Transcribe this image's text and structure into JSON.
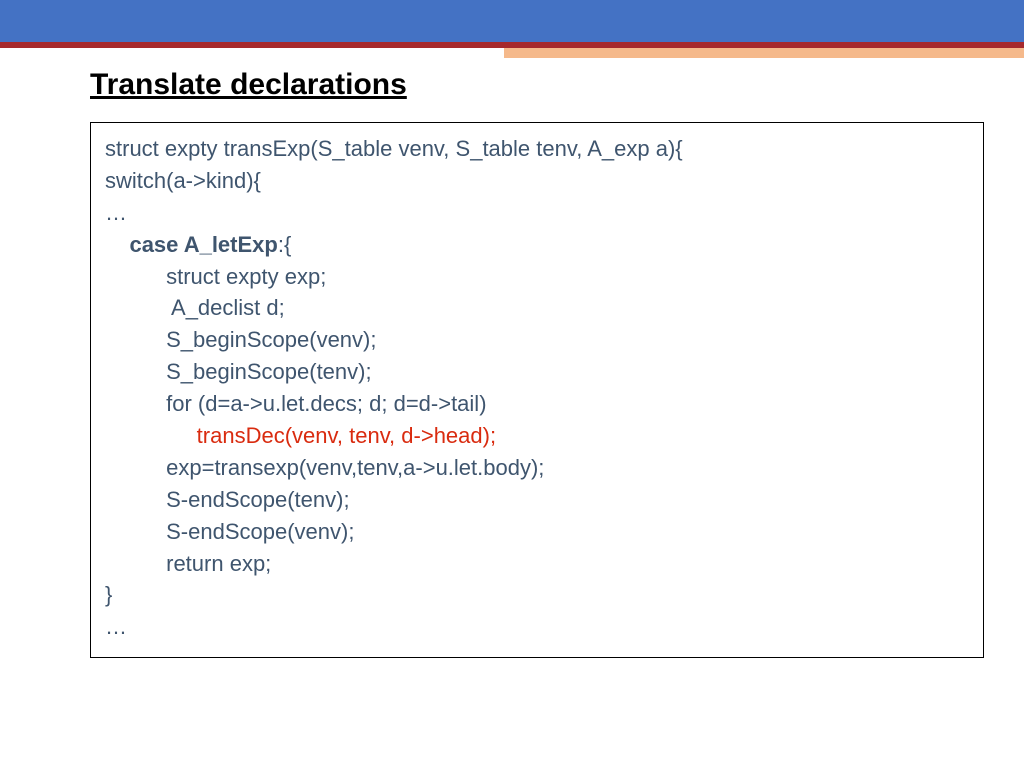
{
  "title": "Translate declarations",
  "code": {
    "l1": "struct expty transExp(S_table venv, S_table tenv, A_exp a){",
    "l2": "switch(a->kind){",
    "l3": "…",
    "l4a": "    ",
    "l4b": "case A_letExp",
    "l4c": ":{",
    "l5": "          struct expty exp;",
    "l6": "           A_declist d;",
    "l7": "          S_beginScope(venv);",
    "l8": "          S_beginScope(tenv);",
    "l9": "",
    "l10": "          for (d=a->u.let.decs; d; d=d->tail)",
    "l11": "               transDec(venv, tenv, d->head);",
    "l12": "          exp=transexp(venv,tenv,a->u.let.body);",
    "l13": "",
    "l14": "          S-endScope(tenv);",
    "l15": "          S-endScope(venv);",
    "l16": "          return exp;",
    "l17": "}",
    "l18": "…"
  }
}
